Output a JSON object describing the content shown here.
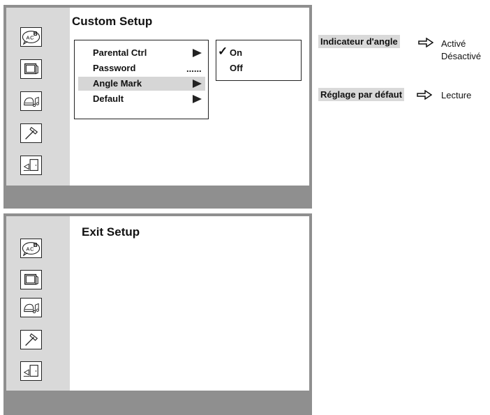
{
  "panel_custom": {
    "title": "Custom Setup",
    "menu_items": [
      "Parental Ctrl",
      "Password",
      "Angle Mark",
      "Default"
    ],
    "password_dots": "......",
    "options": {
      "checkmark": "✓",
      "on": "On",
      "off": "Off"
    }
  },
  "panel_exit": {
    "title": "Exit Setup"
  },
  "annotations": {
    "angle": {
      "label": "Indicateur d'angle",
      "values": [
        "Activé",
        "Désactivé"
      ]
    },
    "default": {
      "label": "Réglage par défaut",
      "values": [
        "Lecture"
      ]
    }
  },
  "icons": [
    "language-icon",
    "tv-icon",
    "audio-icon",
    "settings-hammer-icon",
    "exit-door-icon"
  ]
}
